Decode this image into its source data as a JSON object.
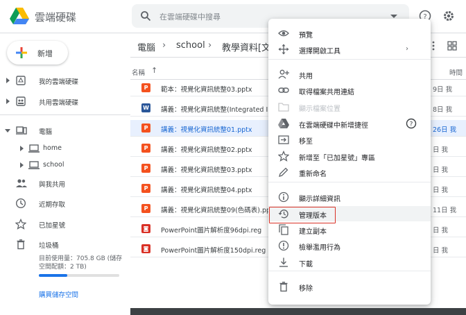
{
  "header": {
    "app_title": "雲端硬碟",
    "search_placeholder": "在雲端硬碟中搜尋"
  },
  "sidebar": {
    "new_label": "新增",
    "items": [
      {
        "label": "我的雲端硬碟",
        "icon": "my-drive-icon"
      },
      {
        "label": "共用雲端硬碟",
        "icon": "shared-drives-icon"
      },
      {
        "label": "電腦",
        "icon": "computer-icon"
      },
      {
        "label": "home",
        "icon": "laptop-icon"
      },
      {
        "label": "school",
        "icon": "laptop-icon"
      },
      {
        "label": "與我共用",
        "icon": "people-icon"
      },
      {
        "label": "近期存取",
        "icon": "clock-icon"
      },
      {
        "label": "已加星號",
        "icon": "star-icon"
      },
      {
        "label": "垃圾桶",
        "icon": "trash-icon"
      }
    ],
    "storage_text": "目前使用量：705.8 GB (儲存空間配額：2 TB)",
    "storage_fraction": 0.35,
    "buy_link": "購買儲存空間"
  },
  "main": {
    "breadcrumb": [
      "電腦",
      "school",
      "教學資料[文"
    ],
    "col_name": "名稱",
    "col_time": "時間",
    "files": [
      {
        "type": "P",
        "name": "範本：視覺化資訊統整03.pptx",
        "date": "9日 我",
        "selected": false
      },
      {
        "type": "W",
        "name": "講義：視覺化資訊統整(Integrated In",
        "date": "8日 我",
        "selected": false
      },
      {
        "type": "P",
        "name": "講義：視覺化資訊統整01.pptx",
        "date": "26日 我",
        "selected": true
      },
      {
        "type": "P",
        "name": "講義：視覺化資訊統整02.pptx",
        "date": "日 我",
        "selected": false
      },
      {
        "type": "P",
        "name": "講義：視覺化資訊統整03.pptx",
        "date": "日 我",
        "selected": false
      },
      {
        "type": "P",
        "name": "講義：視覺化資訊統整04.pptx",
        "date": "日 我",
        "selected": false
      },
      {
        "type": "P",
        "name": "講義：視覺化資訊統整09(色碼表).pp",
        "date": "11日 我",
        "selected": false
      },
      {
        "type": "R",
        "name": "PowerPoint圖片解析度96dpi.reg",
        "date": "日 我",
        "selected": false
      },
      {
        "type": "R",
        "name": "PowerPoint圖片解析度150dpi.reg",
        "date": "日 我",
        "selected": false
      }
    ]
  },
  "menu": {
    "items": [
      {
        "label": "預覽",
        "icon": "eye-icon"
      },
      {
        "label": "選擇開啟工具",
        "icon": "move-arrows-icon",
        "submenu": true
      },
      {
        "label": "共用",
        "icon": "person-add-icon"
      },
      {
        "label": "取得檔案共用連結",
        "icon": "link-icon"
      },
      {
        "label": "顯示檔案位置",
        "icon": "folder-icon",
        "disabled": true
      },
      {
        "label": "在雲端硬碟中新增捷徑",
        "icon": "drive-shortcut-icon",
        "help": true
      },
      {
        "label": "移至",
        "icon": "move-to-icon"
      },
      {
        "label": "新增至「已加星號」專區",
        "icon": "star-outline-icon"
      },
      {
        "label": "重新命名",
        "icon": "pencil-icon"
      },
      {
        "label": "顯示詳細資訊",
        "icon": "info-icon"
      },
      {
        "label": "管理版本",
        "icon": "history-icon",
        "hover": true
      },
      {
        "label": "建立副本",
        "icon": "copy-icon"
      },
      {
        "label": "檢舉濫用行為",
        "icon": "report-icon"
      },
      {
        "label": "下載",
        "icon": "download-icon"
      },
      {
        "label": "移除",
        "icon": "trash-icon"
      }
    ]
  },
  "colors": {
    "accent": "#1a73e8",
    "selected_bg": "#e8f0fe",
    "highlight_box": "#d93025",
    "ppt_icon": "#f4511e",
    "word_icon": "#2a5699",
    "reg_icon": "#d93025"
  }
}
